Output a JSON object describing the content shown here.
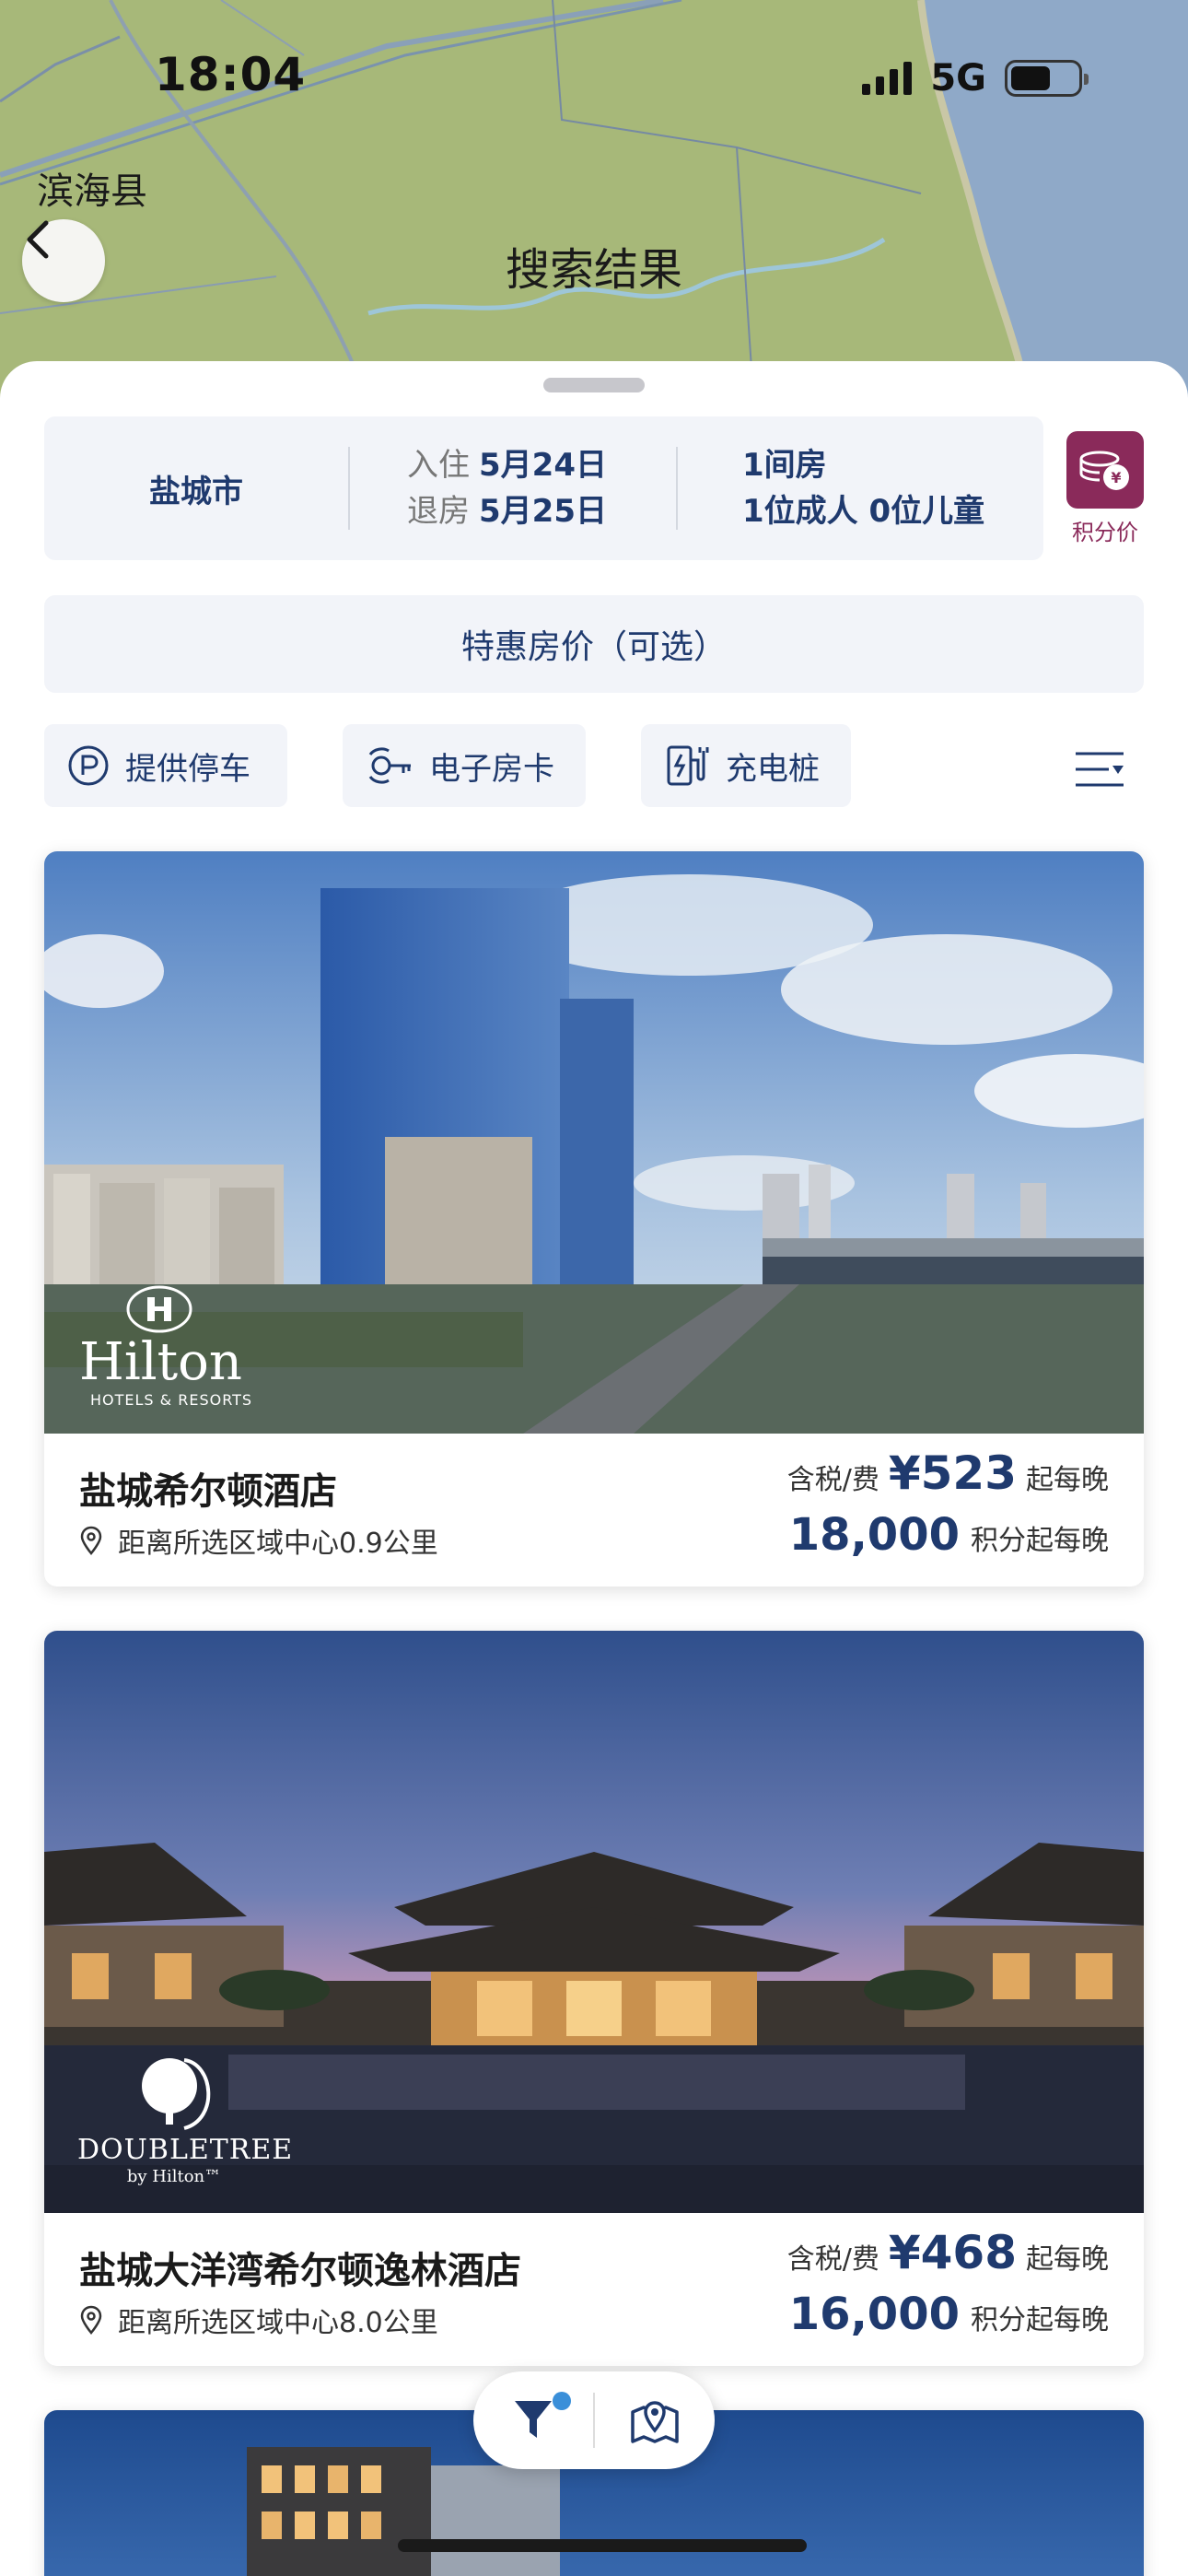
{
  "status_bar": {
    "time": "18:04",
    "network": "5G"
  },
  "map": {
    "place_label": "滨海县"
  },
  "header": {
    "title": "搜索结果"
  },
  "search": {
    "city": "盐城市",
    "checkin_label": "入住",
    "checkin_date": "5月24日",
    "checkout_label": "退房",
    "checkout_date": "5月25日",
    "rooms": "1间房",
    "guests": "1位成人 0位儿童"
  },
  "points_toggle": {
    "label": "积分价",
    "icon": "coins-yen-icon"
  },
  "special_rate": {
    "label": "特惠房价（可选）"
  },
  "filters": [
    {
      "label": "提供停车",
      "icon": "parking-icon"
    },
    {
      "label": "电子房卡",
      "icon": "digital-key-icon"
    },
    {
      "label": "充电桩",
      "icon": "ev-charger-icon"
    }
  ],
  "hotels": [
    {
      "name": "盐城希尔顿酒店",
      "distance": "距离所选区域中心0.9公里",
      "tax_label": "含税/费",
      "price": "¥523",
      "price_unit": "起每晚",
      "points": "18,000",
      "points_unit": "积分起每晚",
      "brand": {
        "name": "Hilton",
        "sub": "HOTELS & RESORTS"
      }
    },
    {
      "name": "盐城大洋湾希尔顿逸林酒店",
      "distance": "距离所选区域中心8.0公里",
      "tax_label": "含税/费",
      "price": "¥468",
      "price_unit": "起每晚",
      "points": "16,000",
      "points_unit": "积分起每晚",
      "brand": {
        "name": "DOUBLETREE",
        "sub": "by Hilton™"
      }
    }
  ],
  "colors": {
    "brand_navy": "#1f3a6e",
    "points_purple": "#8a2a5a",
    "chip_bg": "#f2f4f9",
    "badge_blue": "#3a8fd9"
  }
}
